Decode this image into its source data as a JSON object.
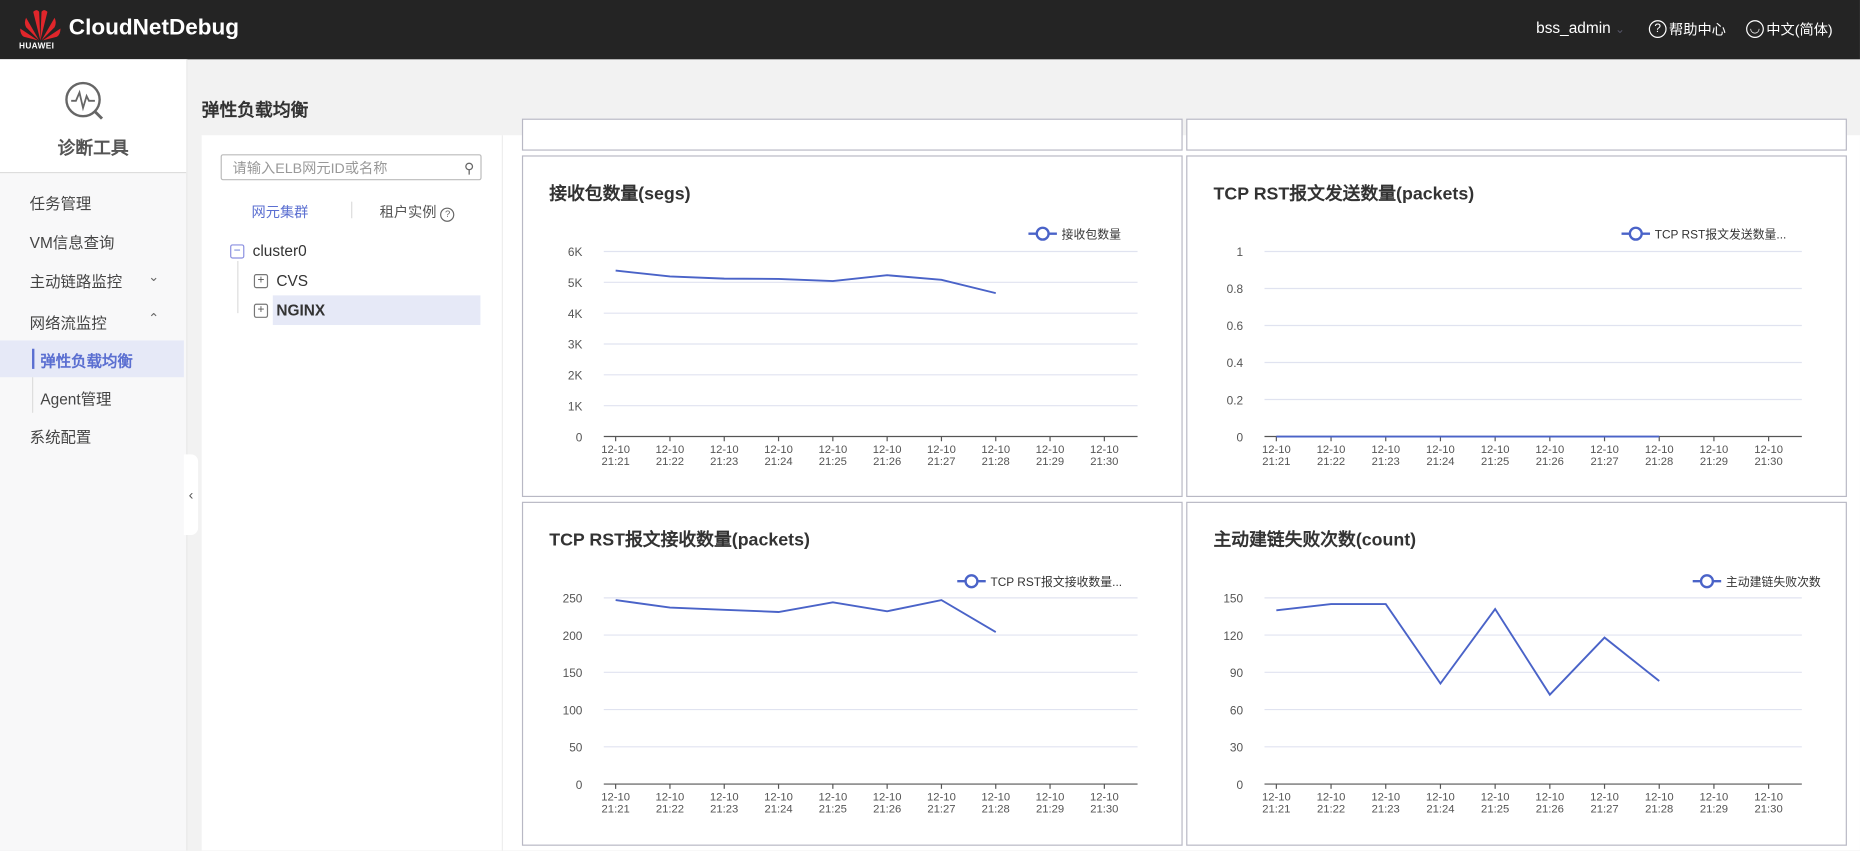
{
  "header": {
    "brand": "HUAWEI",
    "app_name": "CloudNetDebug",
    "user": "bss_admin",
    "help": "帮助中心",
    "language": "中文(简体)"
  },
  "sidebar": {
    "title": "诊断工具",
    "items": [
      {
        "label": "任务管理"
      },
      {
        "label": "VM信息查询"
      },
      {
        "label": "主动链路监控"
      },
      {
        "label": "网络流监控"
      },
      {
        "label": "弹性负载均衡"
      },
      {
        "label": "Agent管理"
      },
      {
        "label": "系统配置"
      }
    ]
  },
  "page_title": "弹性负载均衡",
  "tree": {
    "search_placeholder": "请输入ELB网元ID或名称",
    "tab_cluster": "网元集群",
    "tab_tenant": "租户实例",
    "nodes": [
      "cluster0",
      "CVS",
      "NGINX"
    ]
  },
  "colors": {
    "line": "#4a63c8",
    "accent": "#5b6fd1"
  },
  "chart_data": [
    {
      "type": "line",
      "title": "接收包数量(segs)",
      "legend": "接收包数量",
      "x": [
        "12-10 21:21",
        "12-10 21:22",
        "12-10 21:23",
        "12-10 21:24",
        "12-10 21:25",
        "12-10 21:26",
        "12-10 21:27",
        "12-10 21:28",
        "12-10 21:29",
        "12-10 21:30"
      ],
      "values": [
        5380,
        5190,
        5120,
        5110,
        5040,
        5230,
        5080,
        4650
      ],
      "yticks": [
        0,
        1000,
        2000,
        3000,
        4000,
        5000,
        6000
      ],
      "ytick_labels": [
        "0",
        "1K",
        "2K",
        "3K",
        "4K",
        "5K",
        "6K"
      ],
      "ylim": [
        0,
        6000
      ]
    },
    {
      "type": "line",
      "title": "TCP RST报文发送数量(packets)",
      "legend": "TCP RST报文发送数量...",
      "x": [
        "12-10 21:21",
        "12-10 21:22",
        "12-10 21:23",
        "12-10 21:24",
        "12-10 21:25",
        "12-10 21:26",
        "12-10 21:27",
        "12-10 21:28",
        "12-10 21:29",
        "12-10 21:30"
      ],
      "values": [
        0,
        0,
        0,
        0,
        0,
        0,
        0,
        0
      ],
      "yticks": [
        0,
        0.2,
        0.4,
        0.6,
        0.8,
        1
      ],
      "ytick_labels": [
        "0",
        "0.2",
        "0.4",
        "0.6",
        "0.8",
        "1"
      ],
      "ylim": [
        0,
        1
      ]
    },
    {
      "type": "line",
      "title": "TCP RST报文接收数量(packets)",
      "legend": "TCP RST报文接收数量...",
      "x": [
        "12-10 21:21",
        "12-10 21:22",
        "12-10 21:23",
        "12-10 21:24",
        "12-10 21:25",
        "12-10 21:26",
        "12-10 21:27",
        "12-10 21:28",
        "12-10 21:29",
        "12-10 21:30"
      ],
      "values": [
        247,
        237,
        234,
        231,
        244,
        232,
        247,
        204
      ],
      "yticks": [
        0,
        50,
        100,
        150,
        200,
        250
      ],
      "ytick_labels": [
        "0",
        "50",
        "100",
        "150",
        "200",
        "250"
      ],
      "ylim": [
        0,
        250
      ]
    },
    {
      "type": "line",
      "title": "主动建链失败次数(count)",
      "legend": "主动建链失败次数",
      "x": [
        "12-10 21:21",
        "12-10 21:22",
        "12-10 21:23",
        "12-10 21:24",
        "12-10 21:25",
        "12-10 21:26",
        "12-10 21:27",
        "12-10 21:28",
        "12-10 21:29",
        "12-10 21:30"
      ],
      "values": [
        140,
        145,
        145,
        81,
        141,
        72,
        118,
        83
      ],
      "yticks": [
        0,
        30,
        60,
        90,
        120,
        150
      ],
      "ytick_labels": [
        "0",
        "30",
        "60",
        "90",
        "120",
        "150"
      ],
      "ylim": [
        0,
        150
      ]
    }
  ]
}
